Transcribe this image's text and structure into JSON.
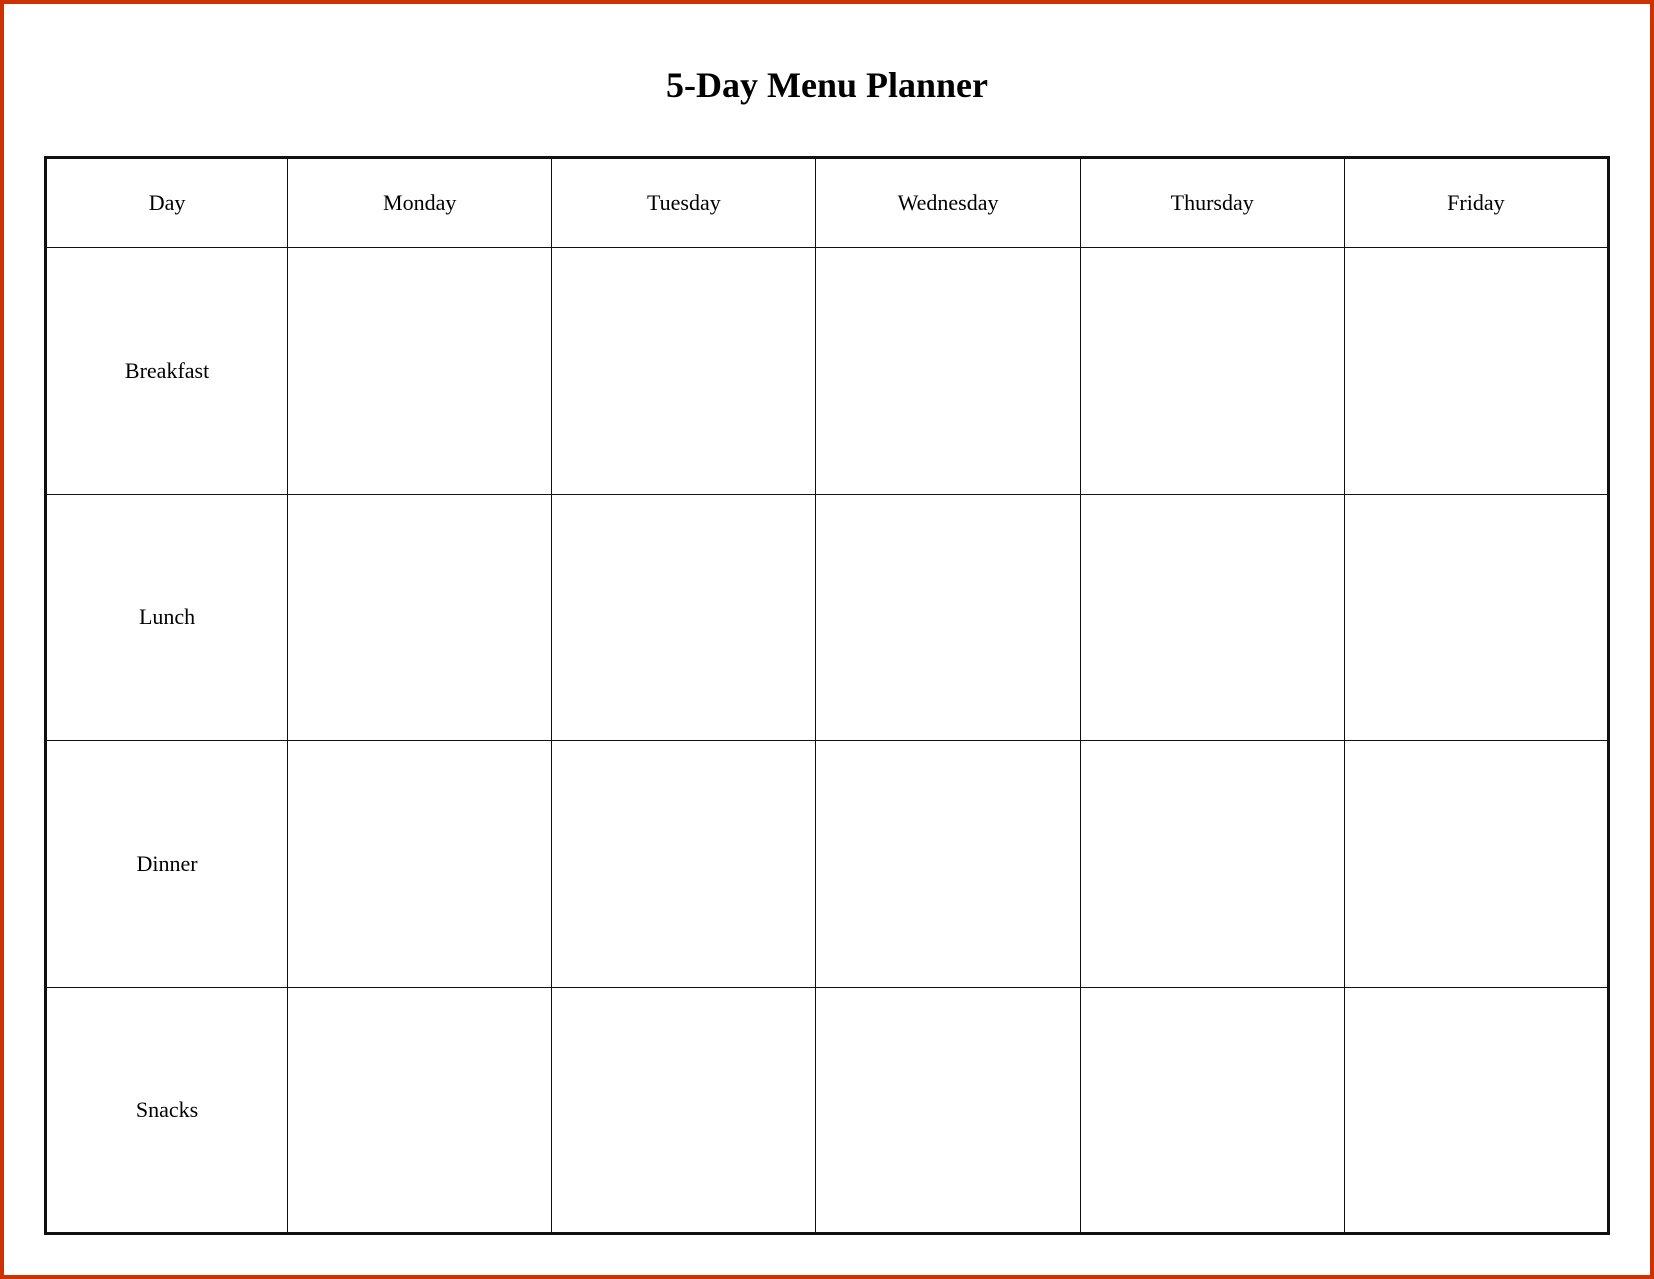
{
  "title": "5-Day Menu Planner",
  "table": {
    "headers": [
      "Day",
      "Monday",
      "Tuesday",
      "Wednesday",
      "Thursday",
      "Friday"
    ],
    "rows": [
      {
        "meal": "Breakfast",
        "cells": [
          "",
          "",
          "",
          "",
          ""
        ]
      },
      {
        "meal": "Lunch",
        "cells": [
          "",
          "",
          "",
          "",
          ""
        ]
      },
      {
        "meal": "Dinner",
        "cells": [
          "",
          "",
          "",
          "",
          ""
        ]
      },
      {
        "meal": "Snacks",
        "cells": [
          "",
          "",
          "",
          "",
          ""
        ]
      }
    ]
  }
}
